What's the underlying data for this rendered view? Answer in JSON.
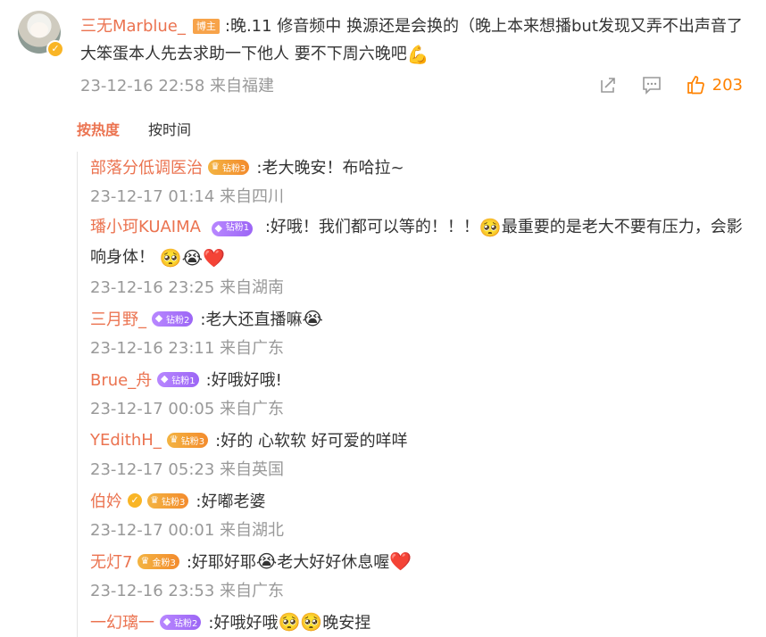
{
  "post": {
    "poster_name": "三无Marblue_",
    "host_badge": "博主",
    "text": ":晚.11 修音频中 换源还是会换的（晚上本来想播but发现又弄不出声音了 大笨蛋本人先去求助一下他人 要不下周六晚吧",
    "text_emoji": "💪",
    "meta": "23-12-16 22:58 来自福建",
    "like_count": "203"
  },
  "tabs": {
    "hot": "按热度",
    "time": "按时间"
  },
  "replies": [
    {
      "name": "部落分低调医治",
      "badge": "钻粉3",
      "badge_style": "crown",
      "content": ":老大晚安！布哈拉~",
      "emojis": "",
      "date": "23-12-17 01:14 来自四川"
    },
    {
      "name": "璠小珂KUAIMA",
      "badge": "钻粉1",
      "badge_style": "purple",
      "content": ":好哦！我们都可以等的！！！",
      "content_emoji": "🥺",
      "content_cont": "最重要的是老大不要有压力，会影响身体！",
      "emojis": "🥺😭❤️",
      "date": "23-12-16 23:25 来自湖南"
    },
    {
      "name": "三月野_",
      "badge": "钻粉2",
      "badge_style": "purple",
      "content": ":老大还直播嘛",
      "emojis": "😭",
      "date": "23-12-16 23:11 来自广东"
    },
    {
      "name": "Brue_舟",
      "badge": "钻粉1",
      "badge_style": "purple",
      "content": ":好哦好哦!",
      "emojis": "",
      "date": "23-12-17 00:05 来自广东"
    },
    {
      "name": "YEdithH_",
      "badge": "钻粉3",
      "badge_style": "crown",
      "content": ":好的 心软软 好可爱的咩咩",
      "emojis": "",
      "date": "23-12-17 05:23 来自英国"
    },
    {
      "name": "伯妗",
      "badge": "钻粉3",
      "badge_style": "crown",
      "verified": true,
      "content": ":好嘟老婆",
      "emojis": "",
      "date": "23-12-17 00:01 来自湖北"
    },
    {
      "name": "无灯7",
      "badge": "金粉3",
      "badge_style": "crown",
      "content": ":好耶好耶",
      "content_emoji": "😭",
      "content_cont": "老大好好休息喔",
      "emojis": "❤️",
      "date": "23-12-16 23:53 来自广东"
    },
    {
      "name": "一幻璃一",
      "badge": "钻粉2",
      "badge_style": "purple",
      "content": ":好哦好哦",
      "content_emoji": "🥺🥺",
      "content_cont": "晚安捏",
      "emojis": "",
      "date": ""
    }
  ]
}
